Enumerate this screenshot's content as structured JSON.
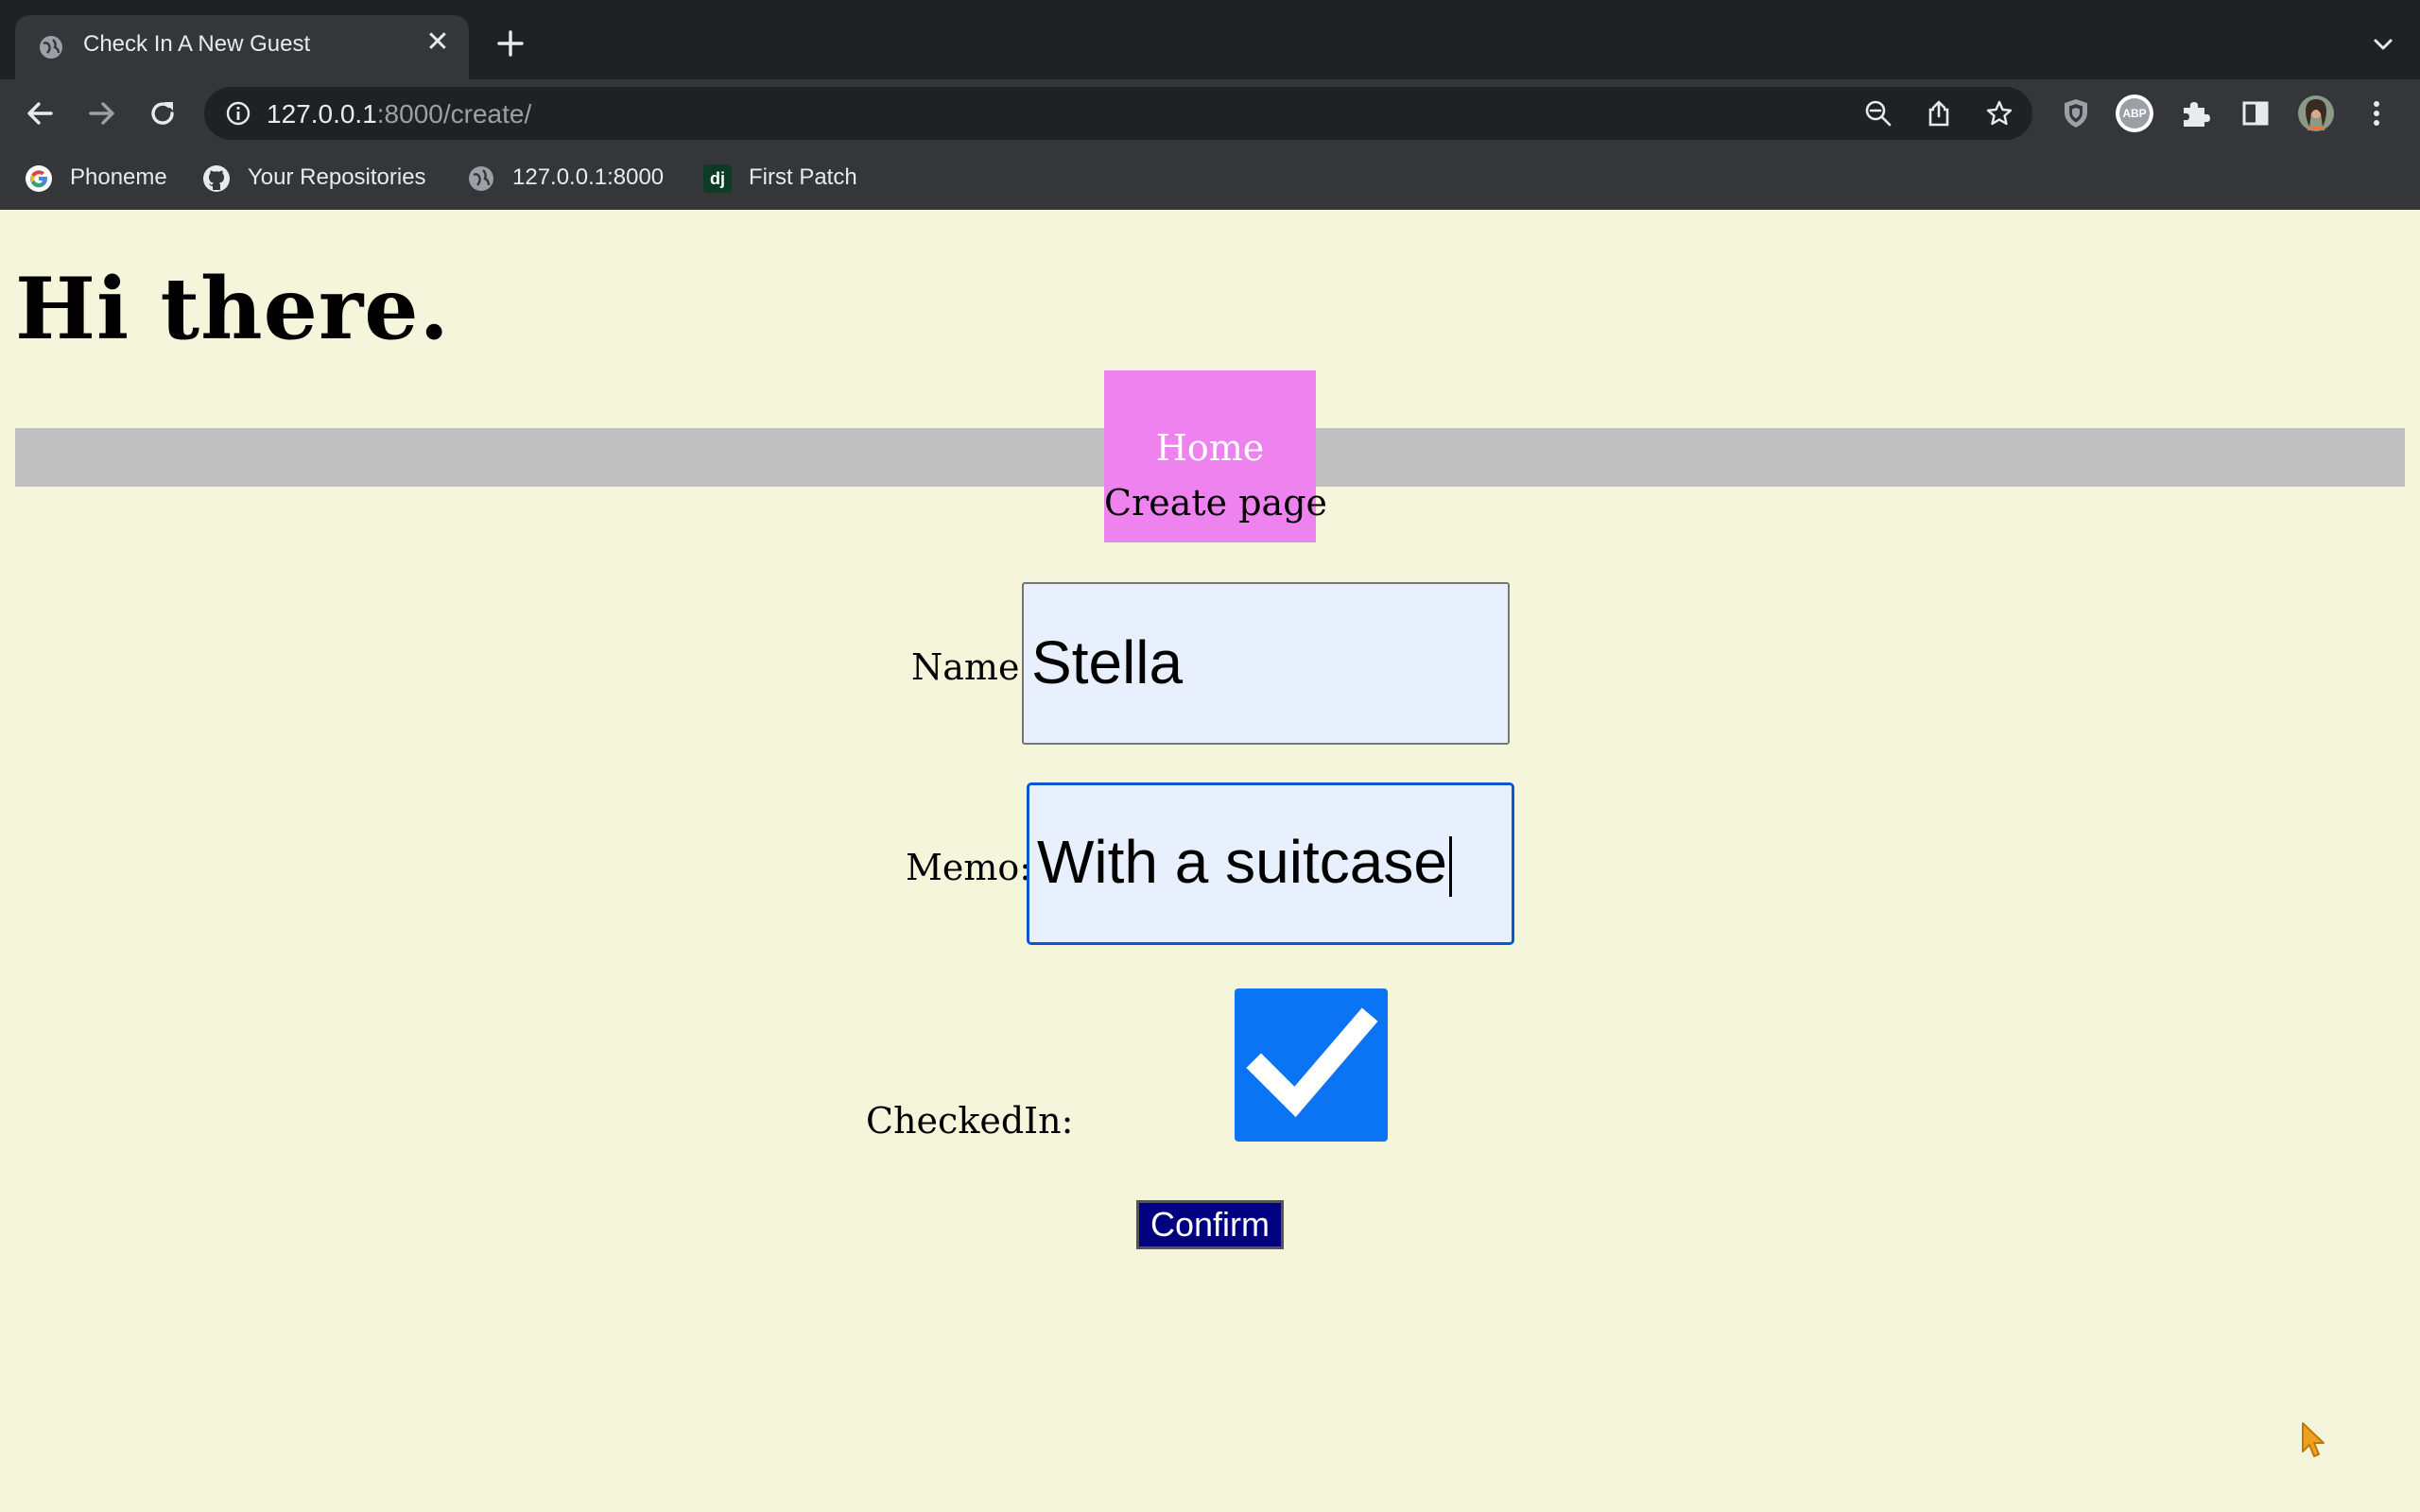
{
  "browser": {
    "tab": {
      "title": "Check In A New Guest",
      "close_glyph": "✕",
      "favicon": "globe-icon"
    },
    "new_tab_glyph": "+",
    "address": {
      "host": "127.0.0.1",
      "path": ":8000/create/"
    },
    "toolbar_icons": [
      "back-arrow-icon",
      "forward-arrow-icon",
      "reload-icon",
      "site-info-icon",
      "zoom-out-icon",
      "share-icon",
      "bookmark-star-icon",
      "shield-extension-icon",
      "adblock-plus-icon",
      "extensions-puzzle-icon",
      "side-panel-icon",
      "profile-avatar",
      "more-menu-icon"
    ],
    "adblock_text": "ABP",
    "bookmarks": [
      {
        "label": "Phoneme",
        "icon": "google-icon"
      },
      {
        "label": "Your Repositories",
        "icon": "github-icon"
      },
      {
        "label": "127.0.0.1:8000",
        "icon": "globe-icon"
      },
      {
        "label": "First Patch",
        "icon": "django-icon",
        "icon_text": "dj"
      }
    ]
  },
  "page": {
    "greeting": "Hi there.",
    "nav": {
      "home": "Home",
      "create": "Create page"
    },
    "form": {
      "name_label": "Name:",
      "name_value": "Stella",
      "memo_label": "Memo:",
      "memo_value": "With a suitcase",
      "checked_in_label": "CheckedIn:",
      "checked_in": true,
      "confirm_label": "Confirm"
    }
  },
  "colors": {
    "page_background": "#f5f5dc",
    "nav_bar": "#c0c0c0",
    "nav_box": "#ee82ee",
    "input_background": "#e8f0fe",
    "focus_border": "#0b57d0",
    "checkbox": "#0b74f5",
    "confirm_button": "#000080"
  }
}
